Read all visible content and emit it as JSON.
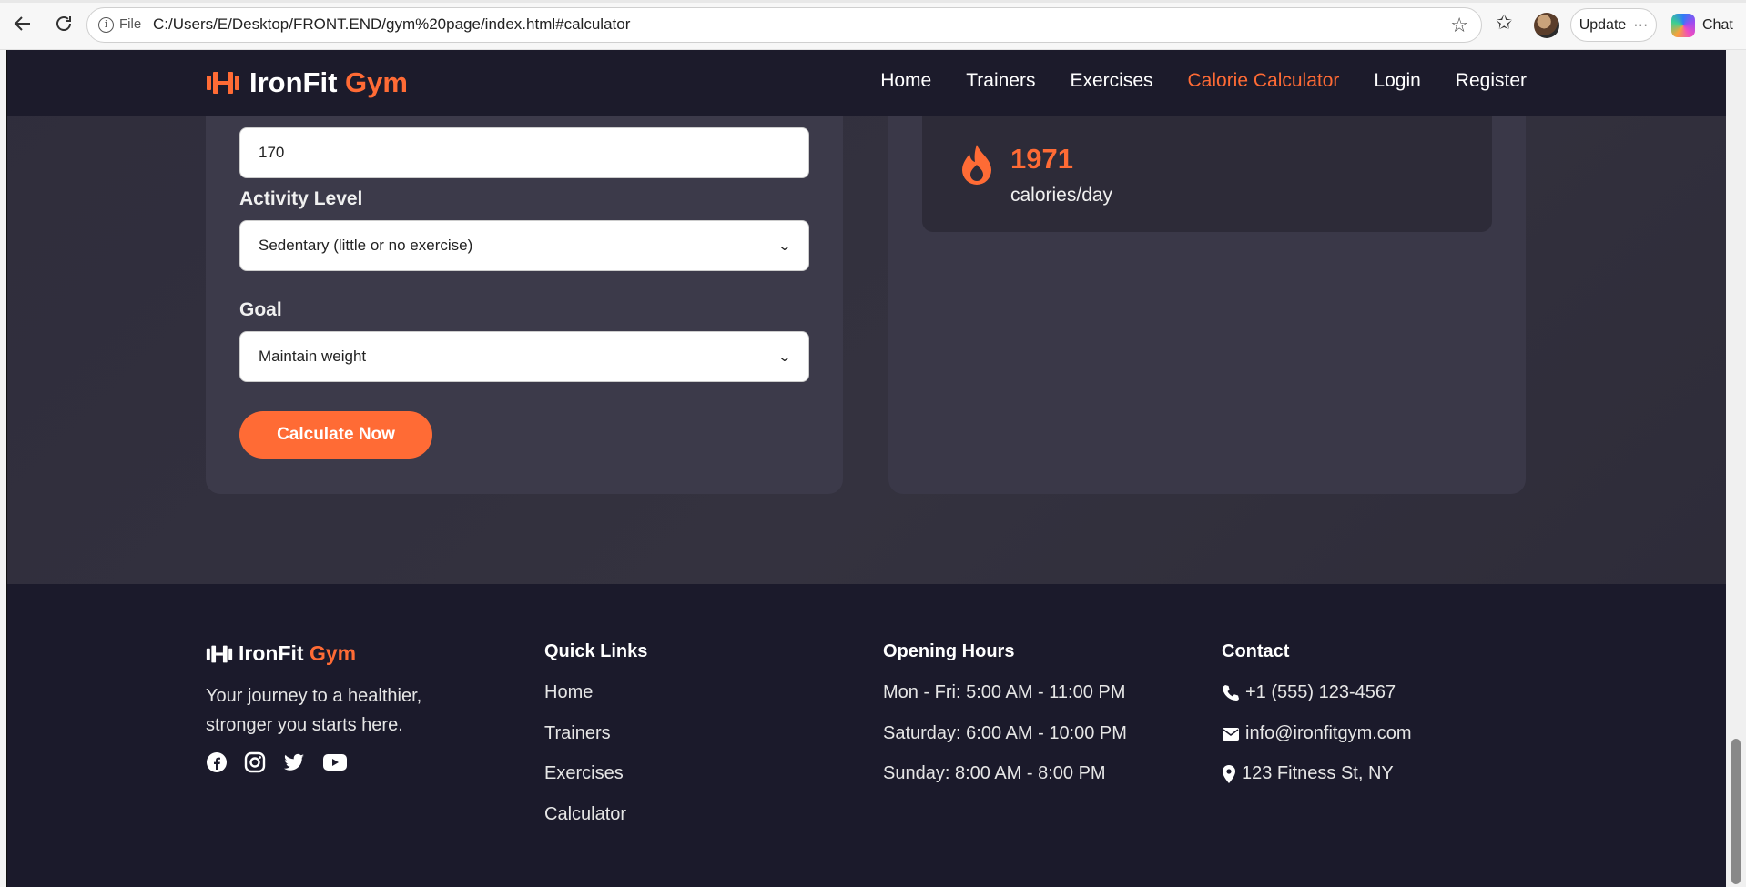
{
  "browser": {
    "file_label": "File",
    "url": "C:/Users/E/Desktop/FRONT.END/gym%20page/index.html#calculator",
    "update_label": "Update",
    "chat_label": "Chat"
  },
  "header": {
    "logo_main": "IronFit",
    "logo_accent": "Gym",
    "nav": [
      "Home",
      "Trainers",
      "Exercises",
      "Calorie Calculator",
      "Login",
      "Register"
    ],
    "active_index": 3,
    "accent_color": "#ff6b35"
  },
  "form": {
    "height_value": "170",
    "activity_label": "Activity Level",
    "activity_value": "Sedentary (little or no exercise)",
    "goal_label": "Goal",
    "goal_value": "Maintain weight",
    "submit_label": "Calculate Now"
  },
  "result": {
    "calories": "1971",
    "unit": "calories/day",
    "icon": "flame-icon"
  },
  "footer": {
    "logo_main": "IronFit",
    "logo_accent": "Gym",
    "tagline": "Your journey to a healthier, stronger you starts here.",
    "socials": [
      "facebook-icon",
      "instagram-icon",
      "twitter-icon",
      "youtube-icon"
    ],
    "quick_links_title": "Quick Links",
    "quick_links": [
      "Home",
      "Trainers",
      "Exercises",
      "Calculator"
    ],
    "hours_title": "Opening Hours",
    "hours": [
      "Mon - Fri: 5:00 AM - 11:00 PM",
      "Saturday: 6:00 AM - 10:00 PM",
      "Sunday: 8:00 AM - 8:00 PM"
    ],
    "contact_title": "Contact",
    "phone": "+1 (555) 123-4567",
    "email": "info@ironfitgym.com",
    "address": "123 Fitness St, NY"
  }
}
